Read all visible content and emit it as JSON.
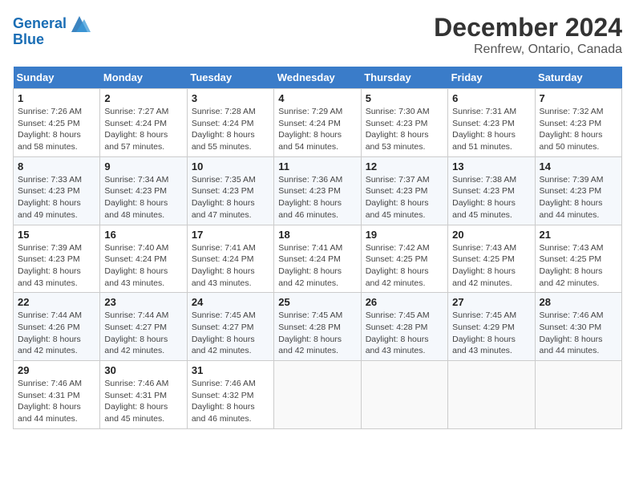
{
  "header": {
    "logo_line1": "General",
    "logo_line2": "Blue",
    "title": "December 2024",
    "subtitle": "Renfrew, Ontario, Canada"
  },
  "days_of_week": [
    "Sunday",
    "Monday",
    "Tuesday",
    "Wednesday",
    "Thursday",
    "Friday",
    "Saturday"
  ],
  "weeks": [
    [
      {
        "day": 1,
        "info": "Sunrise: 7:26 AM\nSunset: 4:25 PM\nDaylight: 8 hours\nand 58 minutes."
      },
      {
        "day": 2,
        "info": "Sunrise: 7:27 AM\nSunset: 4:24 PM\nDaylight: 8 hours\nand 57 minutes."
      },
      {
        "day": 3,
        "info": "Sunrise: 7:28 AM\nSunset: 4:24 PM\nDaylight: 8 hours\nand 55 minutes."
      },
      {
        "day": 4,
        "info": "Sunrise: 7:29 AM\nSunset: 4:24 PM\nDaylight: 8 hours\nand 54 minutes."
      },
      {
        "day": 5,
        "info": "Sunrise: 7:30 AM\nSunset: 4:23 PM\nDaylight: 8 hours\nand 53 minutes."
      },
      {
        "day": 6,
        "info": "Sunrise: 7:31 AM\nSunset: 4:23 PM\nDaylight: 8 hours\nand 51 minutes."
      },
      {
        "day": 7,
        "info": "Sunrise: 7:32 AM\nSunset: 4:23 PM\nDaylight: 8 hours\nand 50 minutes."
      }
    ],
    [
      {
        "day": 8,
        "info": "Sunrise: 7:33 AM\nSunset: 4:23 PM\nDaylight: 8 hours\nand 49 minutes."
      },
      {
        "day": 9,
        "info": "Sunrise: 7:34 AM\nSunset: 4:23 PM\nDaylight: 8 hours\nand 48 minutes."
      },
      {
        "day": 10,
        "info": "Sunrise: 7:35 AM\nSunset: 4:23 PM\nDaylight: 8 hours\nand 47 minutes."
      },
      {
        "day": 11,
        "info": "Sunrise: 7:36 AM\nSunset: 4:23 PM\nDaylight: 8 hours\nand 46 minutes."
      },
      {
        "day": 12,
        "info": "Sunrise: 7:37 AM\nSunset: 4:23 PM\nDaylight: 8 hours\nand 45 minutes."
      },
      {
        "day": 13,
        "info": "Sunrise: 7:38 AM\nSunset: 4:23 PM\nDaylight: 8 hours\nand 45 minutes."
      },
      {
        "day": 14,
        "info": "Sunrise: 7:39 AM\nSunset: 4:23 PM\nDaylight: 8 hours\nand 44 minutes."
      }
    ],
    [
      {
        "day": 15,
        "info": "Sunrise: 7:39 AM\nSunset: 4:23 PM\nDaylight: 8 hours\nand 43 minutes."
      },
      {
        "day": 16,
        "info": "Sunrise: 7:40 AM\nSunset: 4:24 PM\nDaylight: 8 hours\nand 43 minutes."
      },
      {
        "day": 17,
        "info": "Sunrise: 7:41 AM\nSunset: 4:24 PM\nDaylight: 8 hours\nand 43 minutes."
      },
      {
        "day": 18,
        "info": "Sunrise: 7:41 AM\nSunset: 4:24 PM\nDaylight: 8 hours\nand 42 minutes."
      },
      {
        "day": 19,
        "info": "Sunrise: 7:42 AM\nSunset: 4:25 PM\nDaylight: 8 hours\nand 42 minutes."
      },
      {
        "day": 20,
        "info": "Sunrise: 7:43 AM\nSunset: 4:25 PM\nDaylight: 8 hours\nand 42 minutes."
      },
      {
        "day": 21,
        "info": "Sunrise: 7:43 AM\nSunset: 4:25 PM\nDaylight: 8 hours\nand 42 minutes."
      }
    ],
    [
      {
        "day": 22,
        "info": "Sunrise: 7:44 AM\nSunset: 4:26 PM\nDaylight: 8 hours\nand 42 minutes."
      },
      {
        "day": 23,
        "info": "Sunrise: 7:44 AM\nSunset: 4:27 PM\nDaylight: 8 hours\nand 42 minutes."
      },
      {
        "day": 24,
        "info": "Sunrise: 7:45 AM\nSunset: 4:27 PM\nDaylight: 8 hours\nand 42 minutes."
      },
      {
        "day": 25,
        "info": "Sunrise: 7:45 AM\nSunset: 4:28 PM\nDaylight: 8 hours\nand 42 minutes."
      },
      {
        "day": 26,
        "info": "Sunrise: 7:45 AM\nSunset: 4:28 PM\nDaylight: 8 hours\nand 43 minutes."
      },
      {
        "day": 27,
        "info": "Sunrise: 7:45 AM\nSunset: 4:29 PM\nDaylight: 8 hours\nand 43 minutes."
      },
      {
        "day": 28,
        "info": "Sunrise: 7:46 AM\nSunset: 4:30 PM\nDaylight: 8 hours\nand 44 minutes."
      }
    ],
    [
      {
        "day": 29,
        "info": "Sunrise: 7:46 AM\nSunset: 4:31 PM\nDaylight: 8 hours\nand 44 minutes."
      },
      {
        "day": 30,
        "info": "Sunrise: 7:46 AM\nSunset: 4:31 PM\nDaylight: 8 hours\nand 45 minutes."
      },
      {
        "day": 31,
        "info": "Sunrise: 7:46 AM\nSunset: 4:32 PM\nDaylight: 8 hours\nand 46 minutes."
      },
      null,
      null,
      null,
      null
    ]
  ]
}
